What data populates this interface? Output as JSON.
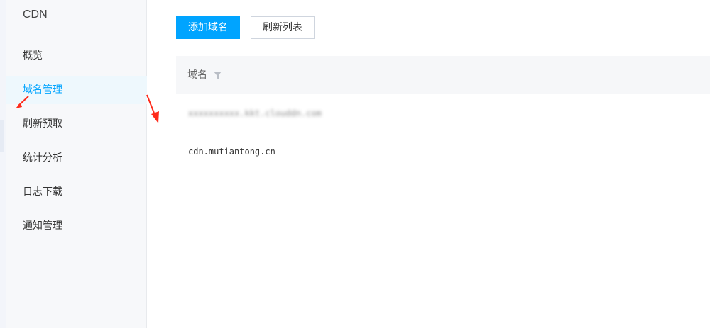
{
  "sidebar": {
    "title": "CDN",
    "items": [
      {
        "label": "概览"
      },
      {
        "label": "域名管理",
        "active": true
      },
      {
        "label": "刷新预取"
      },
      {
        "label": "统计分析"
      },
      {
        "label": "日志下载"
      },
      {
        "label": "通知管理"
      }
    ]
  },
  "toolbar": {
    "add_domain_label": "添加域名",
    "refresh_list_label": "刷新列表"
  },
  "table": {
    "header": {
      "domain_label": "域名",
      "filter_icon": "filter-icon"
    },
    "rows": [
      {
        "domain": "xxxxxxxxxx.kkt.clouddn.com",
        "obscured": true
      },
      {
        "domain": "cdn.mutiantong.cn"
      }
    ]
  },
  "colors": {
    "accent": "#00a4ff",
    "annotation_arrow": "#ff2a1a"
  }
}
